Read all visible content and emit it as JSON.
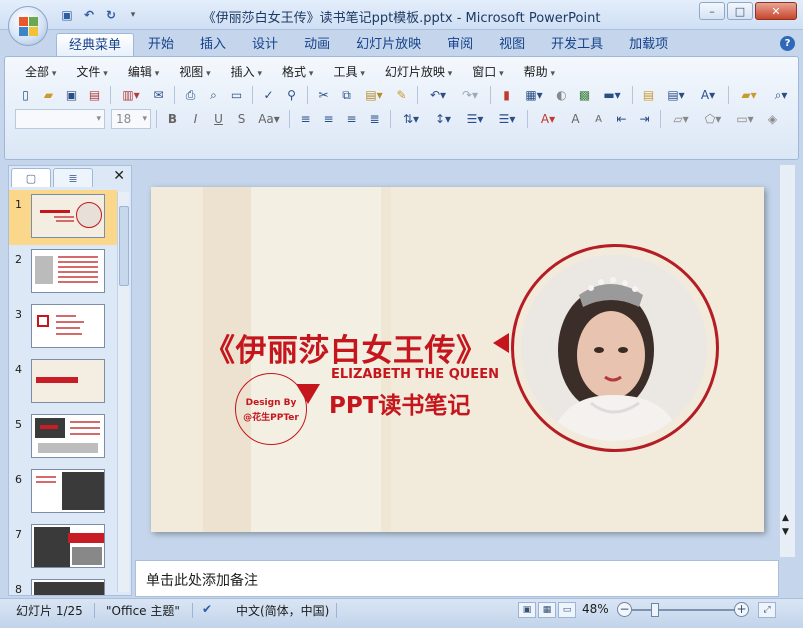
{
  "window": {
    "title": "《伊丽莎白女王传》读书笔记ppt模板.pptx - Microsoft PowerPoint",
    "minimize": "–",
    "maximize": "□",
    "close": "✕"
  },
  "quick_access": {
    "save_icon": "save-icon",
    "undo_icon": "undo-icon",
    "redo_icon": "redo-icon",
    "customize_icon": "customize-icon"
  },
  "ribbon_tabs": [
    "经典菜单",
    "开始",
    "插入",
    "设计",
    "动画",
    "幻灯片放映",
    "审阅",
    "视图",
    "开发工具",
    "加载项"
  ],
  "menu": [
    "全部",
    "文件",
    "编辑",
    "视图",
    "插入",
    "格式",
    "工具",
    "幻灯片放映",
    "窗口",
    "帮助"
  ],
  "font_size": "18",
  "colors": {
    "accent_red": "#c4161c",
    "slide_bg": "#f2eada",
    "ribbon_blue": "#dbe7f6"
  },
  "slides_panel": {
    "tab_slides": "▢",
    "tab_outline": "≣",
    "close": "✕",
    "thumbnails": [
      {
        "number": "1"
      },
      {
        "number": "2"
      },
      {
        "number": "3"
      },
      {
        "number": "4"
      },
      {
        "number": "5"
      },
      {
        "number": "6"
      },
      {
        "number": "7"
      },
      {
        "number": "8"
      }
    ]
  },
  "slide": {
    "title": "《伊丽莎白女王传》",
    "english_subtitle": "ELIZABETH THE QUEEN",
    "subtitle": "PPT读书笔记",
    "design_by": "Design By",
    "author": "@花生PPTer"
  },
  "notes": {
    "placeholder": "单击此处添加备注"
  },
  "status": {
    "slide_info": "幻灯片 1/25",
    "theme": "\"Office 主题\"",
    "language": "中文(简体，中国)",
    "zoom": "48%"
  }
}
